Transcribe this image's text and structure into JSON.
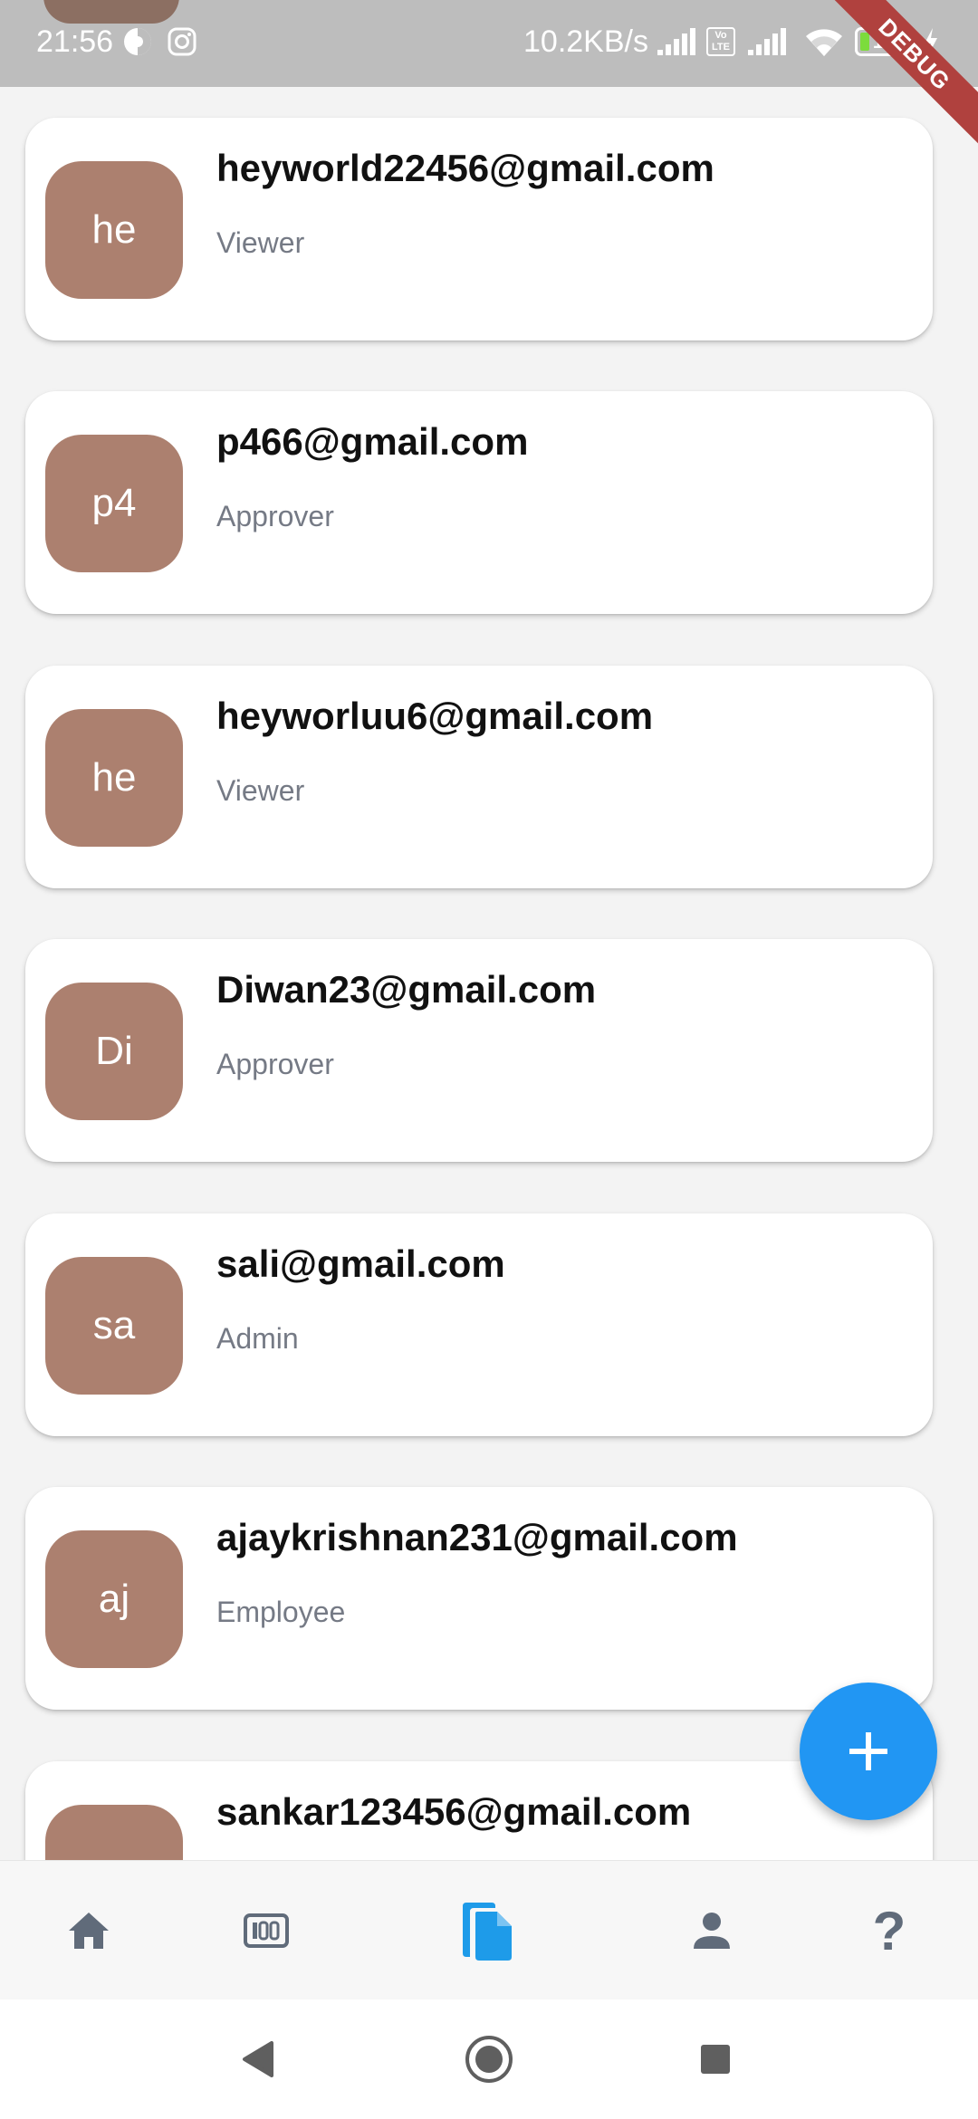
{
  "status_bar": {
    "time": "21:56",
    "network_speed": "10.2KB/s",
    "battery_level": "15",
    "volte_top": "Vo",
    "volte_bottom": "LTE"
  },
  "debug_banner": "DEBUG",
  "users": [
    {
      "initials": "he",
      "email": "heyworld22456@gmail.com",
      "role": "Viewer"
    },
    {
      "initials": "p4",
      "email": "p466@gmail.com",
      "role": "Approver"
    },
    {
      "initials": "he",
      "email": "heyworluu6@gmail.com",
      "role": "Viewer"
    },
    {
      "initials": "Di",
      "email": "Diwan23@gmail.com",
      "role": "Approver"
    },
    {
      "initials": "sa",
      "email": "sali@gmail.com",
      "role": "Admin"
    },
    {
      "initials": "aj",
      "email": "ajaykrishnan231@gmail.com",
      "role": "Employee"
    },
    {
      "initials": "",
      "email": "sankar123456@gmail.com",
      "role": ""
    }
  ],
  "fab": {
    "icon": "plus-icon"
  },
  "bottom_nav": {
    "items": [
      {
        "icon": "home-icon",
        "active": false
      },
      {
        "icon": "dashboard-icon",
        "active": false
      },
      {
        "icon": "documents-icon",
        "active": true
      },
      {
        "icon": "profile-icon",
        "active": false
      },
      {
        "icon": "help-icon",
        "glyph": "?",
        "active": false
      }
    ]
  },
  "colors": {
    "accent": "#2196f3",
    "avatar": "#ac806f",
    "nav_inactive": "#606b7a",
    "nav_active": "#1e9be9",
    "role_text": "#757a85"
  }
}
